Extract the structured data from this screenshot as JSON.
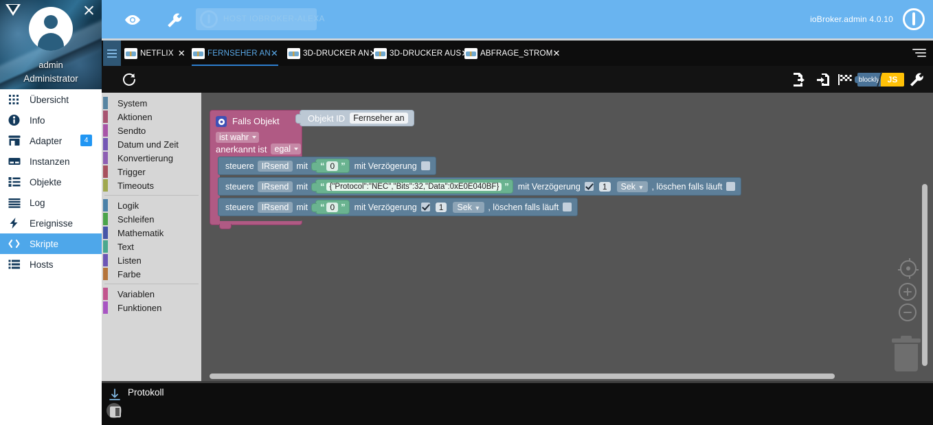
{
  "app": {
    "version_label": "ioBroker.admin 4.0.10",
    "host_label": "HOST IOBROKER-ALEXA"
  },
  "profile": {
    "username": "admin",
    "role": "Administrator",
    "close_icon": "close-icon",
    "logo_icon": "triangle-logo-icon"
  },
  "sidebar": {
    "items": [
      {
        "label": "Übersicht",
        "icon": "grid-icon",
        "badge": "",
        "active": false
      },
      {
        "label": "Info",
        "icon": "info-icon",
        "badge": "",
        "active": false
      },
      {
        "label": "Adapter",
        "icon": "store-icon",
        "badge": "4",
        "active": false
      },
      {
        "label": "Instanzen",
        "icon": "instances-icon",
        "badge": "",
        "active": false
      },
      {
        "label": "Objekte",
        "icon": "objects-list-icon",
        "badge": "",
        "active": false
      },
      {
        "label": "Log",
        "icon": "log-lines-icon",
        "badge": "",
        "active": false
      },
      {
        "label": "Ereignisse",
        "icon": "bolt-icon",
        "badge": "",
        "active": false
      },
      {
        "label": "Skripte",
        "icon": "code-brackets-icon",
        "badge": "",
        "active": true
      },
      {
        "label": "Hosts",
        "icon": "hosts-icon",
        "badge": "",
        "active": false
      }
    ]
  },
  "topbar": {
    "eye_icon": "eye-icon",
    "wrench_icon": "wrench-icon",
    "power_icon": "power-icon"
  },
  "tabs": {
    "menu_icon": "hamburger-menu-icon",
    "overflow_icon": "tab-overflow-menu-icon",
    "items": [
      {
        "label": "NETFLIX",
        "active": false,
        "closable": true
      },
      {
        "label": "FERNSEHER AN",
        "active": true,
        "closable": true
      },
      {
        "label": "3D-DRUCKER AN",
        "active": false,
        "closable": true
      },
      {
        "label": "3D-DRUCKER AUS",
        "active": false,
        "closable": true
      },
      {
        "label": "ABFRAGE_STROM",
        "active": false,
        "closable": true
      }
    ]
  },
  "script_toolbar": {
    "refresh_icon": "refresh-icon",
    "export_icon": "export-script-icon",
    "import_icon": "import-script-icon",
    "checkered_flag_icon": "debug-flag-icon",
    "wrench_icon": "settings-wrench-icon",
    "mode_toggle": {
      "left_label": "blockly",
      "right_label": "JS"
    }
  },
  "toolbox": {
    "groups": [
      {
        "items": [
          {
            "label": "System",
            "color": "#5885a2"
          },
          {
            "label": "Aktionen",
            "color": "#a85571"
          },
          {
            "label": "Sendto",
            "color": "#a855a8"
          },
          {
            "label": "Datum und Zeit",
            "color": "#7457b5"
          },
          {
            "label": "Konvertierung",
            "color": "#8e5fb3"
          },
          {
            "label": "Trigger",
            "color": "#a8515e"
          },
          {
            "label": "Timeouts",
            "color": "#a0a84e"
          }
        ]
      },
      {
        "items": [
          {
            "label": "Logik",
            "color": "#4b81a8"
          },
          {
            "label": "Schleifen",
            "color": "#4ba44b"
          },
          {
            "label": "Mathematik",
            "color": "#4655a8"
          },
          {
            "label": "Text",
            "color": "#4aa88e"
          },
          {
            "label": "Listen",
            "color": "#6c55b5"
          },
          {
            "label": "Farbe",
            "color": "#b5743a"
          }
        ]
      },
      {
        "items": [
          {
            "label": "Variablen",
            "color": "#c2558e"
          },
          {
            "label": "Funktionen",
            "color": "#a855c2"
          }
        ]
      }
    ]
  },
  "workspace": {
    "if_block": {
      "gear_icon": "block-gear-icon",
      "title": "Falls Objekt",
      "condition": "ist wahr",
      "ack_prefix": "anerkannt ist",
      "ack_value": "egal",
      "color": "#b05a84"
    },
    "object_id_block": {
      "label": "Objekt ID",
      "value": "Fernseher an",
      "color": "#bcc8d4"
    },
    "statements": [
      {
        "verb": "steuere",
        "target": "IRsend",
        "with_label": "mit",
        "value": "0",
        "delay_label": "mit Verzögerung",
        "delay_checked": false,
        "delay_amount": "",
        "delay_unit": "",
        "clear_label": "",
        "clear_checked": false
      },
      {
        "verb": "steuere",
        "target": "IRsend",
        "with_label": "mit",
        "value": "{\"Protocol\":\"NEC\",\"Bits\":32,\"Data\":0xE0E040BF}",
        "delay_label": "mit Verzögerung",
        "delay_checked": true,
        "delay_amount": "1",
        "delay_unit": "Sek",
        "clear_label": ", löschen falls läuft",
        "clear_checked": false
      },
      {
        "verb": "steuere",
        "target": "IRsend",
        "with_label": "mit",
        "value": "0",
        "delay_label": "mit Verzögerung",
        "delay_checked": true,
        "delay_amount": "1",
        "delay_unit": "Sek",
        "clear_label": ", löschen falls läuft",
        "clear_checked": false
      }
    ],
    "zoom_controls": {
      "center_icon": "zoom-center-icon",
      "zoom_in_icon": "zoom-in-icon",
      "zoom_out_icon": "zoom-out-icon",
      "trash_icon": "trash-icon"
    }
  },
  "log_panel": {
    "title": "Protokoll",
    "download_icon": "download-log-icon",
    "layout_icon": "log-layout-icon"
  },
  "colors": {
    "accent": "#69b4f0",
    "sidebar_active": "#4ea7ea",
    "badge": "#2196f3",
    "canvas": "#555555",
    "toolbox": "#d6d6d6",
    "block_if": "#b05a84",
    "block_statement": "#5d7f99",
    "block_string": "#6ab390",
    "js_toggle": "#ffc107"
  }
}
